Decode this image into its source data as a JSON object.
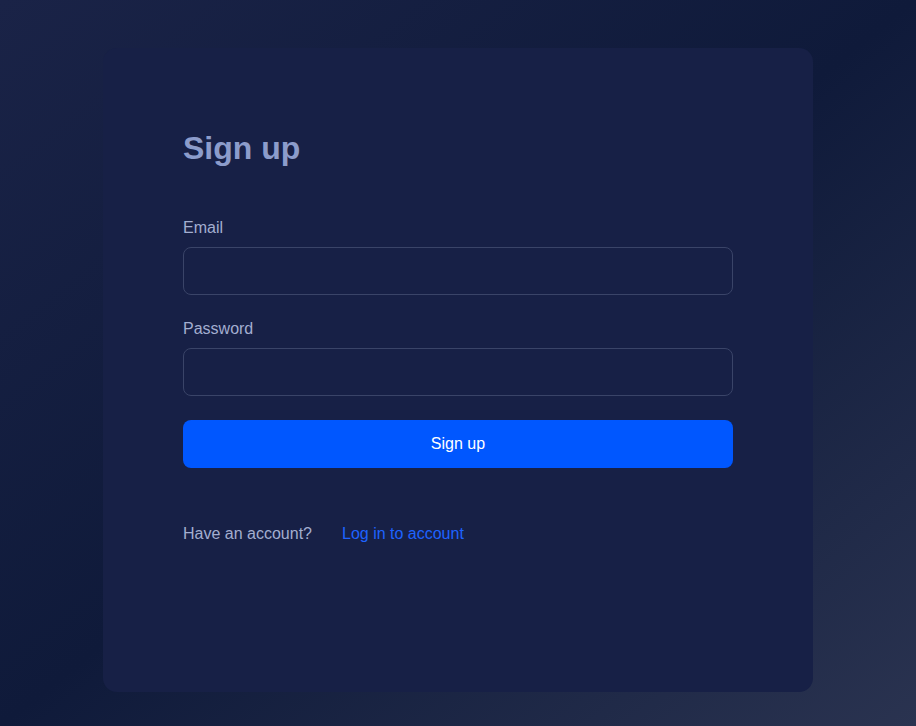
{
  "form": {
    "title": "Sign up",
    "fields": [
      {
        "label": "Email",
        "type": "email"
      },
      {
        "label": "Password",
        "type": "password"
      }
    ],
    "submit": "Sign up"
  },
  "footer": {
    "text": "Have an account?",
    "link": "Log in to account"
  }
}
